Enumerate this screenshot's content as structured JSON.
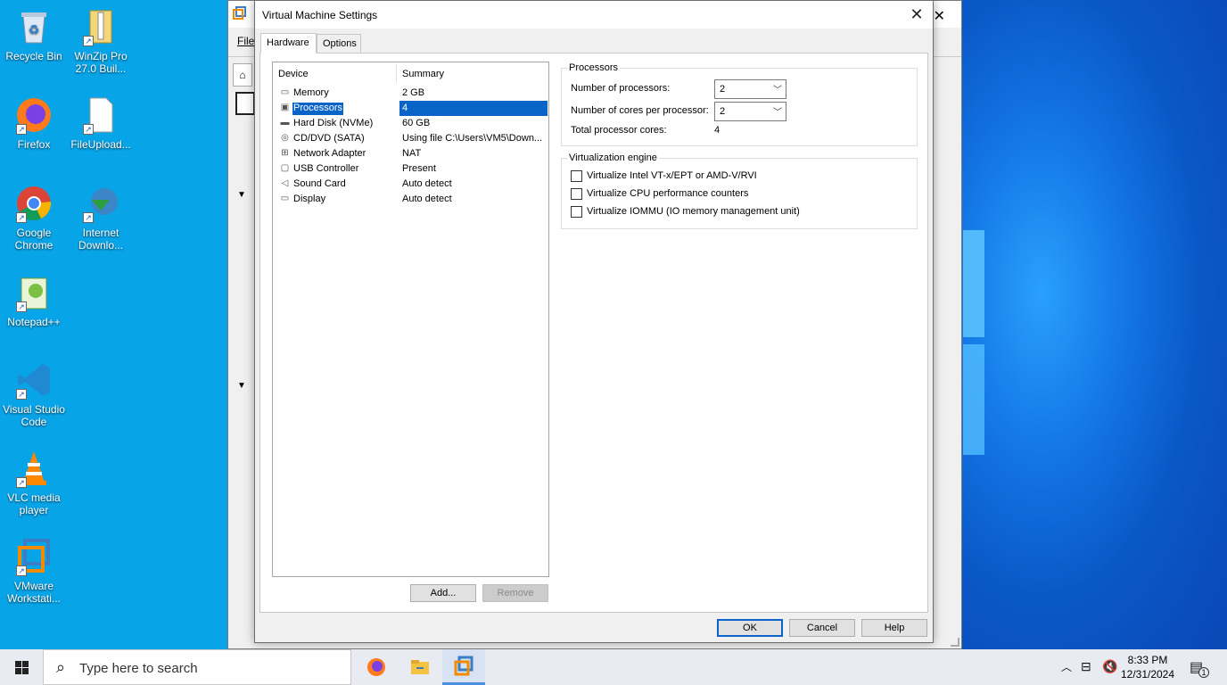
{
  "desktop": {
    "icons": [
      {
        "label": "Recycle Bin",
        "icon": "recycle-bin-icon"
      },
      {
        "label": "WinZip Pro 27.0 Buil...",
        "icon": "winzip-icon"
      },
      {
        "label": "Firefox",
        "icon": "firefox-icon"
      },
      {
        "label": "FileUpload...",
        "icon": "file-icon"
      },
      {
        "label": "Google Chrome",
        "icon": "chrome-icon"
      },
      {
        "label": "Internet Downlo...",
        "icon": "idm-icon"
      },
      {
        "label": "Notepad++",
        "icon": "notepadpp-icon"
      },
      {
        "label": "Visual Studio Code",
        "icon": "vscode-icon"
      },
      {
        "label": "VLC media player",
        "icon": "vlc-icon"
      },
      {
        "label": "VMware Workstati...",
        "icon": "vmware-icon"
      }
    ]
  },
  "background_window": {
    "menu_file": "File"
  },
  "dialog": {
    "title": "Virtual Machine Settings",
    "tabs": [
      {
        "label": "Hardware",
        "active": true
      },
      {
        "label": "Options",
        "active": false
      }
    ],
    "device_list": {
      "headers": {
        "device": "Device",
        "summary": "Summary"
      },
      "rows": [
        {
          "device": "Memory",
          "summary": "2 GB",
          "icon": "memory-icon",
          "selected": false
        },
        {
          "device": "Processors",
          "summary": "4",
          "icon": "processor-icon",
          "selected": true
        },
        {
          "device": "Hard Disk (NVMe)",
          "summary": "60 GB",
          "icon": "hard-disk-icon",
          "selected": false
        },
        {
          "device": "CD/DVD (SATA)",
          "summary": "Using file C:\\Users\\VM5\\Down...",
          "icon": "cd-dvd-icon",
          "selected": false
        },
        {
          "device": "Network Adapter",
          "summary": "NAT",
          "icon": "network-adapter-icon",
          "selected": false
        },
        {
          "device": "USB Controller",
          "summary": "Present",
          "icon": "usb-icon",
          "selected": false
        },
        {
          "device": "Sound Card",
          "summary": "Auto detect",
          "icon": "sound-icon",
          "selected": false
        },
        {
          "device": "Display",
          "summary": "Auto detect",
          "icon": "display-icon",
          "selected": false
        }
      ]
    },
    "add_button": "Add...",
    "remove_button": "Remove",
    "processors_group": {
      "title": "Processors",
      "num_processors_label": "Number of processors:",
      "num_processors_value": "2",
      "cores_label": "Number of cores per processor:",
      "cores_value": "2",
      "total_label": "Total processor cores:",
      "total_value": "4"
    },
    "virtualization_group": {
      "title": "Virtualization engine",
      "options": [
        {
          "label": "Virtualize Intel VT-x/EPT or AMD-V/RVI",
          "checked": false
        },
        {
          "label": "Virtualize CPU performance counters",
          "checked": false
        },
        {
          "label": "Virtualize IOMMU (IO memory management unit)",
          "checked": false
        }
      ]
    },
    "ok_button": "OK",
    "cancel_button": "Cancel",
    "help_button": "Help"
  },
  "taskbar": {
    "search_placeholder": "Type here to search",
    "time": "8:33 PM",
    "date": "12/31/2024",
    "notification_count": "1"
  }
}
